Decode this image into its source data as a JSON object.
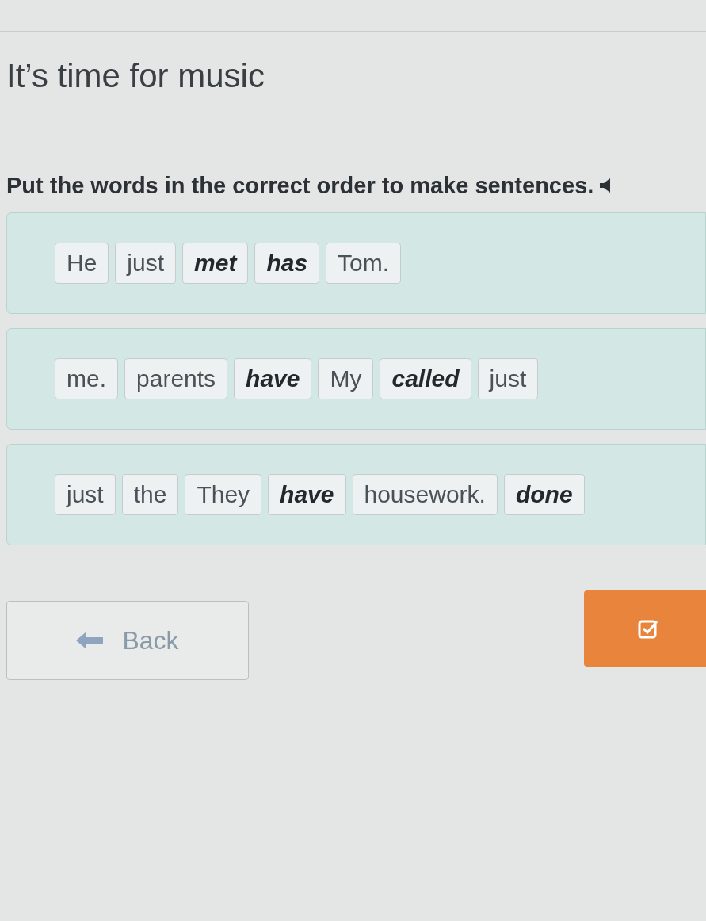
{
  "title": "It’s time for music",
  "instruction": "Put the words in the correct order to make sentences.",
  "sentences": [
    {
      "words": [
        {
          "text": "He",
          "emphasis": false
        },
        {
          "text": "just",
          "emphasis": false
        },
        {
          "text": "met",
          "emphasis": true
        },
        {
          "text": "has",
          "emphasis": true
        },
        {
          "text": "Tom.",
          "emphasis": false
        }
      ]
    },
    {
      "words": [
        {
          "text": "me.",
          "emphasis": false
        },
        {
          "text": "parents",
          "emphasis": false
        },
        {
          "text": "have",
          "emphasis": true
        },
        {
          "text": "My",
          "emphasis": false
        },
        {
          "text": "called",
          "emphasis": true
        },
        {
          "text": "just",
          "emphasis": false
        }
      ]
    },
    {
      "words": [
        {
          "text": "just",
          "emphasis": false
        },
        {
          "text": "the",
          "emphasis": false
        },
        {
          "text": "They",
          "emphasis": false
        },
        {
          "text": "have",
          "emphasis": true
        },
        {
          "text": "housework.",
          "emphasis": false
        },
        {
          "text": "done",
          "emphasis": true
        }
      ]
    }
  ],
  "back_button": "Back"
}
